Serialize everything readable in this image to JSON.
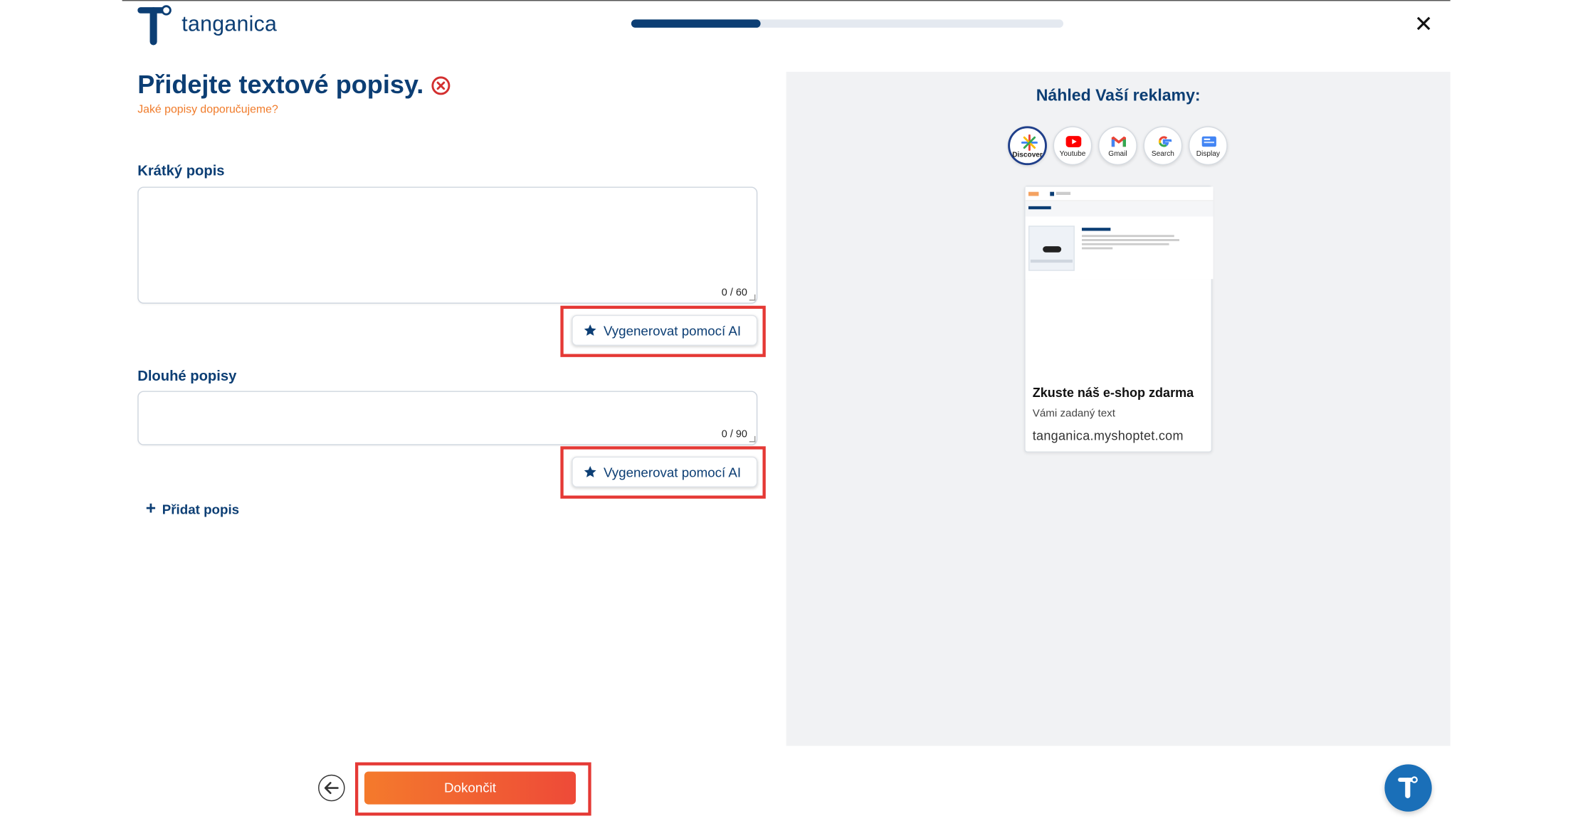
{
  "header": {
    "logo_text": "tanganica",
    "progress_fraction": 0.3,
    "close_label": "✕"
  },
  "main": {
    "title": "Přidejte textové popisy.",
    "help_link": "Jaké popisy doporučujeme?",
    "short_description": {
      "label": "Krátký popis",
      "value": "",
      "counter": "0 / 60",
      "ai_button": "Vygenerovat pomocí AI"
    },
    "long_description": {
      "label": "Dlouhé popisy",
      "value": "",
      "counter": "0 / 90",
      "ai_button": "Vygenerovat pomocí AI"
    },
    "add_description": "Přidat popis"
  },
  "preview": {
    "title": "Náhled Vaší reklamy:",
    "channels": [
      {
        "label": "Discover",
        "icon": "discover-icon",
        "active": true
      },
      {
        "label": "Youtube",
        "icon": "youtube-icon",
        "active": false
      },
      {
        "label": "Gmail",
        "icon": "gmail-icon",
        "active": false
      },
      {
        "label": "Search",
        "icon": "google-search-icon",
        "active": false
      },
      {
        "label": "Display",
        "icon": "display-icon",
        "active": false
      }
    ],
    "ad": {
      "headline": "Zkuste náš e-shop zdarma",
      "description": "Vámi zadaný text",
      "url": "tanganica.myshoptet.com"
    }
  },
  "footer": {
    "finish_button": "Dokončit"
  },
  "colors": {
    "brand_navy": "#0c3e74",
    "accent_orange": "#f07b2a",
    "highlight_red": "#e53935",
    "panel_bg": "#f1f2f4"
  }
}
